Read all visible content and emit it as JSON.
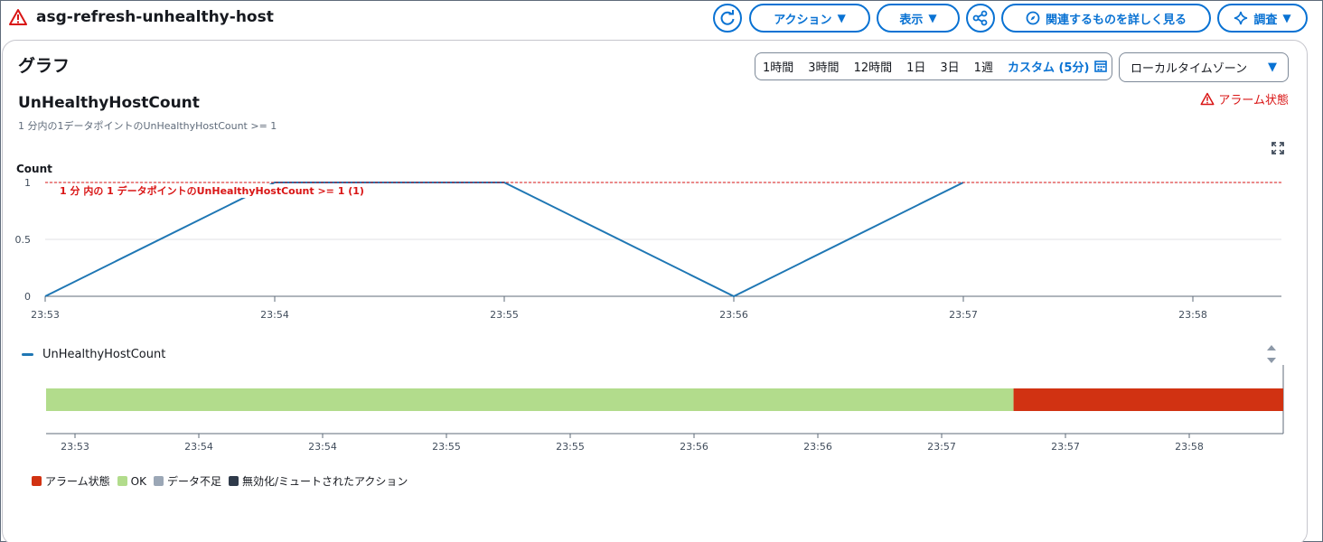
{
  "header": {
    "title": "asg-refresh-unhealthy-host",
    "actions_label": "アクション",
    "view_label": "表示",
    "related_label": "関連するものを詳しく見る",
    "investigate_label": "調査"
  },
  "section": {
    "title": "グラフ",
    "time_ranges": [
      "1時間",
      "3時間",
      "12時間",
      "1日",
      "3日",
      "1週"
    ],
    "custom_range": "カスタム (5分)",
    "timezone": "ローカルタイムゾーン"
  },
  "metric": {
    "title": "UnHealthyHostCount",
    "subtitle": "1 分内の1データポイントのUnHealthyHostCount >= 1",
    "alarm_state": "アラーム状態"
  },
  "chart_data": {
    "type": "line",
    "ylabel": "Count",
    "ylim": [
      0,
      1
    ],
    "y_ticks": [
      "0",
      "0.5",
      "1"
    ],
    "x_ticks": [
      "23:53",
      "23:54",
      "23:55",
      "23:56",
      "23:57",
      "23:58"
    ],
    "series": [
      {
        "name": "UnHealthyHostCount",
        "color": "#1f77b4",
        "x": [
          "23:53",
          "23:54",
          "23:55",
          "23:56",
          "23:57"
        ],
        "values": [
          0,
          1,
          1,
          0,
          1
        ]
      }
    ],
    "threshold": {
      "value": 1,
      "label": "1 分 内の 1 データポイントのUnHealthyHostCount >= 1 (1)",
      "color": "#d91515"
    }
  },
  "timeline": {
    "ticks": [
      "23:53",
      "23:54",
      "23:54",
      "23:55",
      "23:55",
      "23:56",
      "23:56",
      "23:57",
      "23:57",
      "23:58"
    ],
    "ok_color": "#b2dc8c",
    "alarm_color": "#d13212",
    "ok_fraction": 0.782
  },
  "state_legend": [
    {
      "label": "アラーム状態",
      "color": "#d13212"
    },
    {
      "label": "OK",
      "color": "#b2dc8c"
    },
    {
      "label": "データ不足",
      "color": "#9ba7b6"
    },
    {
      "label": "無効化/ミュートされたアクション",
      "color": "#2f3a4a"
    }
  ]
}
